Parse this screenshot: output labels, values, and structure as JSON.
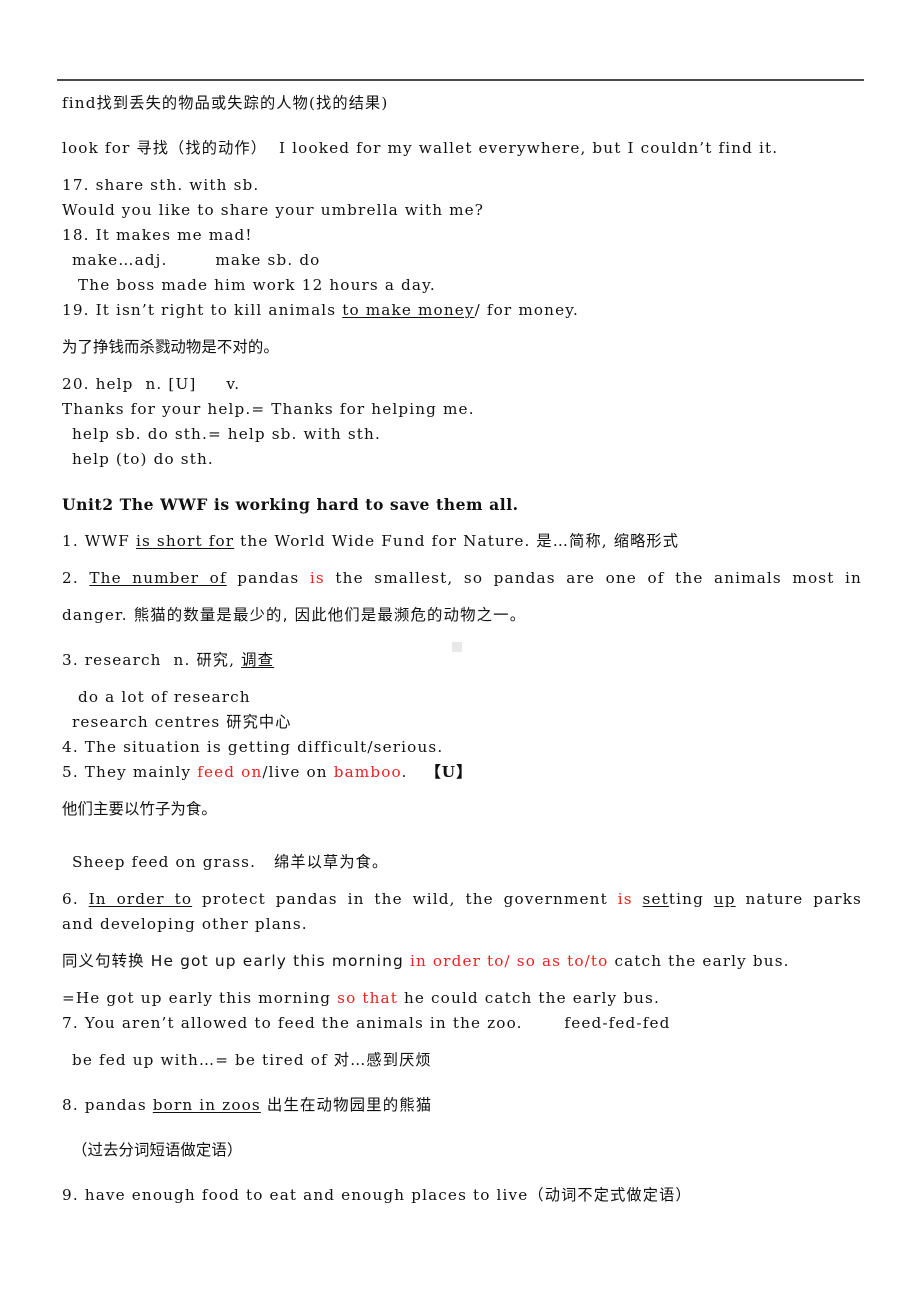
{
  "document": {
    "title": "Unit2 The WWF is working hard to save them all.",
    "colors": {
      "ink": "#111111",
      "accent_red": "#ee1f20",
      "rule": "#4a4a4a"
    }
  },
  "lines": {
    "l01": "find找到丢失的物品或失踪的人物(找的结果)",
    "l02": "look for 寻找（找的动作）  I looked for my wallet everywhere, but I couldn’t find it.",
    "l03": "17. share sth. with sb.",
    "l04": "Would you like to share your umbrella with me?",
    "l05": "18. It makes me mad!",
    "l06": "make…adj.        make sb. do",
    "l07": "The boss made him work 12 hours a day.",
    "l08a": "19. It isn’t right to kill animals ",
    "l08b": "to make money",
    "l08c": "/ for money.",
    "l09": "为了挣钱而杀戮动物是不对的。",
    "l10": "20. help  n. [U]     v.",
    "l11": "Thanks for your help.= Thanks for helping me.",
    "l12": "help sb. do sth.= help sb. with sth.",
    "l13": "help (to) do sth.",
    "unit_heading": "Unit2 The WWF is working hard to save them all.",
    "l14a": "1. WWF ",
    "l14b": "is short for",
    "l14c": " the World Wide Fund for Nature. 是…简称, 缩略形式",
    "l15a": "2. ",
    "l15b": "The number of",
    "l15c": " pandas ",
    "l15d": "is",
    "l15e": " the smallest, so pandas are one of the animals most in",
    "l16a": "danger. ",
    "l16b": "熊猫的数量是最少的, 因此他们是最濒危的动物之一。",
    "l17a": "3. research  n. 研究, ",
    "l17b": "调查",
    "l18": "do a lot of research",
    "l19": "research centres 研究中心",
    "l20": "4. The situation is getting difficult/serious.",
    "l21a": "5. They mainly ",
    "l21b": "feed on",
    "l21c": "/live on ",
    "l21d": "bamboo",
    "l21e": ".   ",
    "l21f": "【U】",
    "l22": "他们主要以竹子为食。",
    "l23": "Sheep feed on grass.   绵羊以草为食。",
    "l24a": "6. ",
    "l24b": "In order to",
    "l24c": " protect pandas in the wild, the government ",
    "l24d": "is",
    "l24e": " ",
    "l24f": "set",
    "l24g": "ting ",
    "l24h": "up",
    "l24i": " nature parks",
    "l25": "and developing other plans.",
    "l26a": "同义句转换 He got up early this morning ",
    "l26b": "in order to/ so as to/to",
    "l26c": " catch the early bus.",
    "l27a": "=He got up early this morning ",
    "l27b": "so that",
    "l27c": " he could catch the early bus.",
    "l28": "7. You aren’t allowed to feed the animals in the zoo.       feed-fed-fed",
    "l29": "be fed up with…= be tired of 对…感到厌烦",
    "l30a": "8. pandas ",
    "l30b": "born in zoos",
    "l30c": " 出生在动物园里的熊猫",
    "l31": "（过去分词短语做定语）",
    "l32": "9. have enough food to eat and enough places to live（动词不定式做定语）"
  }
}
